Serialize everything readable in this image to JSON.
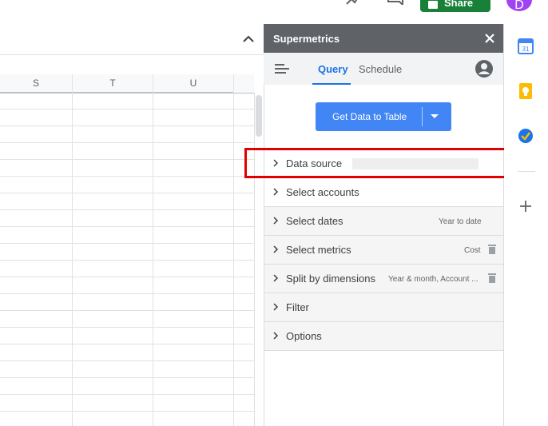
{
  "header": {
    "share_label": "Share",
    "avatar_initial": "D"
  },
  "sheet": {
    "columns": [
      "S",
      "T",
      "U"
    ]
  },
  "panel": {
    "title": "Supermetrics",
    "tabs": [
      {
        "label": "Query",
        "active": true
      },
      {
        "label": "Schedule",
        "active": false
      }
    ],
    "get_data_label": "Get Data to Table",
    "sections": [
      {
        "label": "Data source",
        "value": ""
      },
      {
        "label": "Select accounts",
        "value": ""
      },
      {
        "label": "Select dates",
        "value": "Year to date"
      },
      {
        "label": "Select metrics",
        "value": "Cost"
      },
      {
        "label": "Split by dimensions",
        "value": "Year & month, Account ..."
      },
      {
        "label": "Filter",
        "value": ""
      },
      {
        "label": "Options",
        "value": ""
      }
    ]
  },
  "colors": {
    "accent": "#1a73e8",
    "button": "#4285f4",
    "header_bg": "#5f6368",
    "highlight": "#e00000",
    "share_green": "#188038"
  },
  "rail": {
    "icons": [
      "calendar-icon",
      "keep-icon",
      "tasks-icon",
      "add-icon"
    ]
  }
}
